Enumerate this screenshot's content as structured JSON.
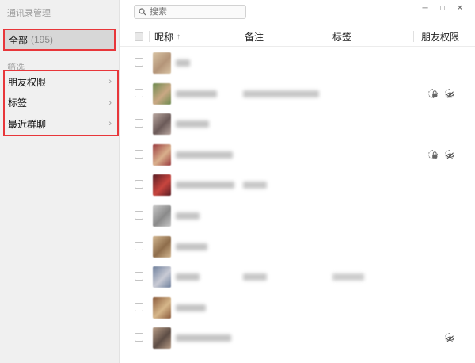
{
  "sidebar": {
    "title": "通讯录管理",
    "all_label": "全部",
    "all_count": "(195)",
    "filter_label": "筛选",
    "filters": [
      "朋友权限",
      "标签",
      "最近群聊"
    ]
  },
  "search": {
    "placeholder": "搜索"
  },
  "window": {
    "minimize": "─",
    "maximize": "□",
    "close": "✕"
  },
  "columns": {
    "nickname": "昵称",
    "sort_icon": "↑",
    "remark": "备注",
    "tag": "标签",
    "permission": "朋友权限"
  },
  "colors": {
    "highlight_border": "#e8363a",
    "sidebar_bg": "#f0f0f0",
    "selected_bg": "#d7d7d7"
  },
  "rows": [
    {
      "avatar": [
        "#d8c3a3",
        "#b49579"
      ],
      "name_w": 18,
      "remark_w": 0,
      "tag_w": 0,
      "lock": false,
      "eye": false
    },
    {
      "avatar": [
        "#6d8a4f",
        "#caa884"
      ],
      "name_w": 52,
      "remark_w": 96,
      "tag_w": 0,
      "lock": true,
      "eye": true
    },
    {
      "avatar": [
        "#b9a7a0",
        "#6b5a58"
      ],
      "name_w": 42,
      "remark_w": 0,
      "tag_w": 0,
      "lock": false,
      "eye": false
    },
    {
      "avatar": [
        "#9a3b3e",
        "#d9b08c"
      ],
      "name_w": 72,
      "remark_w": 0,
      "tag_w": 0,
      "lock": true,
      "eye": true
    },
    {
      "avatar": [
        "#5a1e24",
        "#c8453e"
      ],
      "name_w": 74,
      "remark_w": 30,
      "tag_w": 0,
      "lock": false,
      "eye": false
    },
    {
      "avatar": [
        "#c8c8c8",
        "#8a8a8a"
      ],
      "name_w": 30,
      "remark_w": 0,
      "tag_w": 0,
      "lock": false,
      "eye": false
    },
    {
      "avatar": [
        "#d2b690",
        "#8e6d4b"
      ],
      "name_w": 40,
      "remark_w": 0,
      "tag_w": 0,
      "lock": false,
      "eye": false
    },
    {
      "avatar": [
        "#6e7f9c",
        "#c9cbd5"
      ],
      "name_w": 30,
      "remark_w": 30,
      "tag_w": 40,
      "lock": false,
      "eye": false
    },
    {
      "avatar": [
        "#8a5a3b",
        "#d6b78a"
      ],
      "name_w": 38,
      "remark_w": 0,
      "tag_w": 0,
      "lock": false,
      "eye": false
    },
    {
      "avatar": [
        "#b79c86",
        "#5d4d45"
      ],
      "name_w": 70,
      "remark_w": 0,
      "tag_w": 0,
      "lock": false,
      "eye": true
    }
  ]
}
